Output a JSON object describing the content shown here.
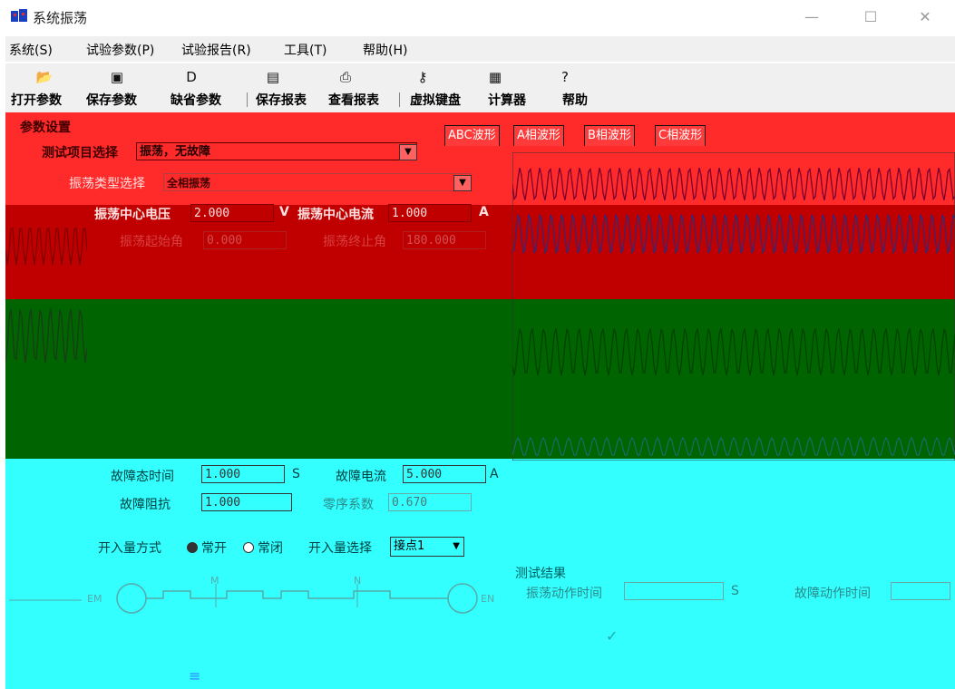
{
  "window": {
    "title": "系统振荡",
    "min_glyph": "—",
    "max_glyph": "☐",
    "close_glyph": "✕"
  },
  "menu": [
    "系统(S)",
    "试验参数(P)",
    "试验报告(R)",
    "工具(T)",
    "帮助(H)"
  ],
  "toolbar": {
    "icons": [
      "folder-open-icon",
      "floppy-disk-icon",
      "default-params-icon",
      "save-report-icon",
      "printer-icon",
      "key-icon",
      "calculator-icon",
      "help-icon"
    ],
    "labels": [
      "打开参数",
      "保存参数",
      "缺省参数",
      "保存报表",
      "查看报表",
      "虚拟键盘",
      "计算器",
      "帮助"
    ]
  },
  "params": {
    "group_title": "参数设置",
    "test_item_label": "测试项目选择",
    "test_item_value": "振荡，无故障",
    "osc_type_label": "振荡类型选择",
    "osc_type_value": "全相振荡",
    "center_voltage_label": "振荡中心电压",
    "center_voltage_value": "2.000",
    "center_voltage_unit": "V",
    "center_current_label": "振荡中心电流",
    "center_current_value": "1.000",
    "center_current_unit": "A",
    "angle_start_label": "振荡起始角",
    "angle_start_value": "0.000",
    "angle_end_label": "振荡终止角",
    "angle_end_value": "180.000",
    "fault_time_label": "故障态时间",
    "fault_time_value": "1.000",
    "fault_time_unit": "S",
    "fault_current_label": "故障电流",
    "fault_current_value": "5.000",
    "fault_current_unit": "A",
    "fault_impedance_label": "故障阻抗",
    "fault_impedance_value": "1.000",
    "zero_seq_label": "零序系数",
    "zero_seq_value": "0.670",
    "input_mode_label": "开入量方式",
    "input_mode_options": [
      "常开",
      "常闭"
    ],
    "input_select_label": "开入量选择",
    "input_select_value": "接点1"
  },
  "tabs": [
    "ABC波形",
    "A相波形",
    "B相波形",
    "C相波形"
  ],
  "diagram": {
    "left_label": "EM",
    "m_label": "M",
    "n_label": "N",
    "right_label": "EN"
  },
  "results": {
    "title": "测试结果",
    "osc_action_label": "振荡动作时间",
    "osc_action_unit": "S",
    "fault_action_label": "故障动作时间"
  },
  "colors": {
    "red": "#ff2a2a",
    "dark_red": "#c00000",
    "green": "#006400",
    "cyan": "#33ffff"
  }
}
